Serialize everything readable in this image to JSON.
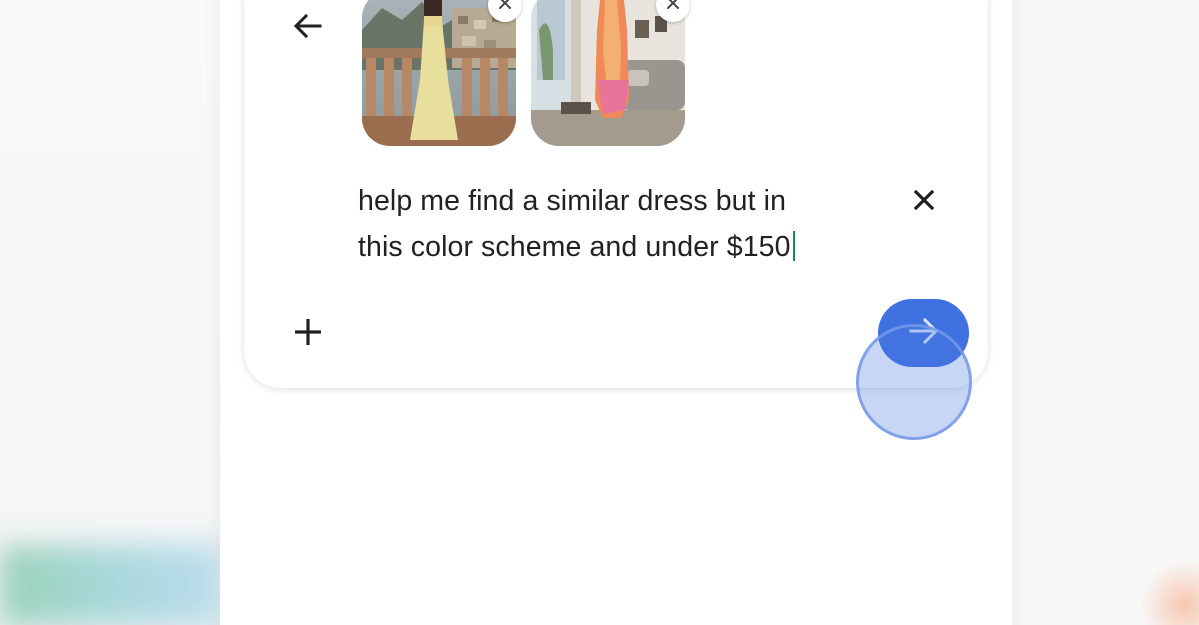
{
  "search": {
    "query_line1": "help me find a similar dress but in",
    "query_line2": "this color scheme and under $150"
  },
  "attachments": [
    {
      "label": "woman in pale yellow dress on a balcony",
      "remove_icon": "close-icon"
    },
    {
      "label": "orange and pink scarf hanging in a room",
      "remove_icon": "close-icon"
    }
  ],
  "icons": {
    "back": "arrow-left-icon",
    "clear": "close-icon",
    "add": "plus-icon",
    "send": "arrow-right-icon"
  },
  "colors": {
    "accent": "#3f72e0",
    "text": "#202124",
    "caret": "#1a8a5c"
  }
}
